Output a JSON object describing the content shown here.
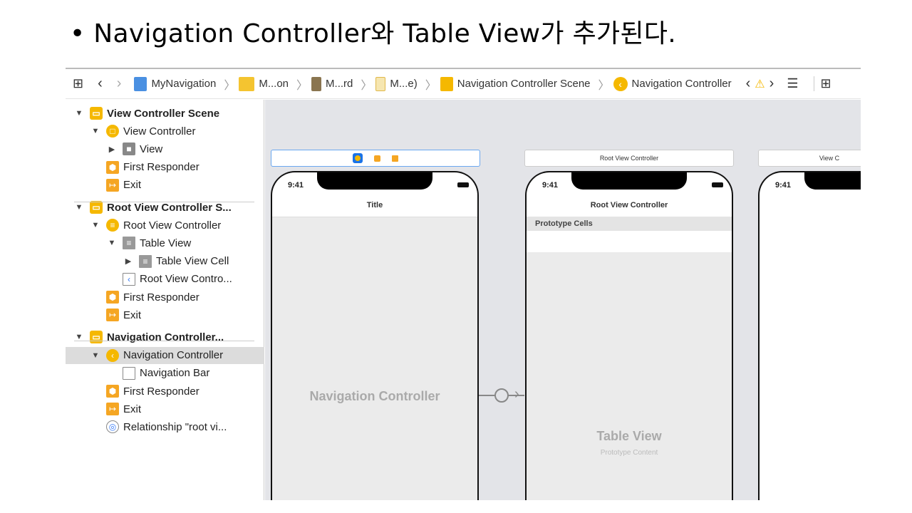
{
  "slide": {
    "title": "• Navigation Controller와 Table View가 추가된다."
  },
  "toolbar": {
    "breadcrumbs": [
      "MyNavigation",
      "M...on",
      "M...rd",
      "M...e)",
      "Navigation Controller Scene",
      "Navigation Controller"
    ]
  },
  "outline": [
    {
      "label": "View Controller Scene",
      "level": 0,
      "bold": true,
      "icon": "scene-icon",
      "arrow": "down"
    },
    {
      "label": "View Controller",
      "level": 1,
      "icon": "view-controller-icon",
      "arrow": "down"
    },
    {
      "label": "View",
      "level": 2,
      "icon": "view-icon",
      "arrow": "right"
    },
    {
      "label": "First Responder",
      "level": 1,
      "icon": "first-responder-icon"
    },
    {
      "label": "Exit",
      "level": 1,
      "icon": "exit-icon"
    },
    {
      "label": "Root View Controller S...",
      "level": 0,
      "bold": true,
      "icon": "scene-icon",
      "arrow": "down"
    },
    {
      "label": "Root View Controller",
      "level": 1,
      "icon": "table-view-controller-icon",
      "arrow": "down"
    },
    {
      "label": "Table View",
      "level": 2,
      "icon": "table-view-icon",
      "arrow": "down"
    },
    {
      "label": "Table View Cell",
      "level": 3,
      "icon": "table-view-cell-icon",
      "arrow": "right"
    },
    {
      "label": "Root View Contro...",
      "level": 2,
      "icon": "navigation-item-icon"
    },
    {
      "label": "First Responder",
      "level": 1,
      "icon": "first-responder-icon"
    },
    {
      "label": "Exit",
      "level": 1,
      "icon": "exit-icon"
    },
    {
      "label": "Navigation Controller...",
      "level": 0,
      "bold": true,
      "icon": "scene-icon",
      "arrow": "down"
    },
    {
      "label": "Navigation Controller",
      "level": 1,
      "icon": "navigation-controller-icon",
      "arrow": "down",
      "selected": true
    },
    {
      "label": "Navigation Bar",
      "level": 2,
      "icon": "navigation-bar-icon"
    },
    {
      "label": "First Responder",
      "level": 1,
      "icon": "first-responder-icon"
    },
    {
      "label": "Exit",
      "level": 1,
      "icon": "exit-icon"
    },
    {
      "label": "Relationship \"root vi...",
      "level": 1,
      "icon": "relationship-icon"
    }
  ],
  "canvas": {
    "scene1": {
      "time": "9:41",
      "nav_title": "Title",
      "center_label": "Navigation Controller"
    },
    "scene2": {
      "header": "Root View Controller",
      "time": "9:41",
      "nav_title": "Root View Controller",
      "section": "Prototype Cells",
      "center_label": "Table View",
      "center_sub": "Prototype Content"
    },
    "scene3": {
      "header": "View C",
      "time": "9:41"
    }
  },
  "colors": {
    "accent": "#f5b800",
    "canvas": "#e3e4e8",
    "selection": "#dcdcdc"
  }
}
